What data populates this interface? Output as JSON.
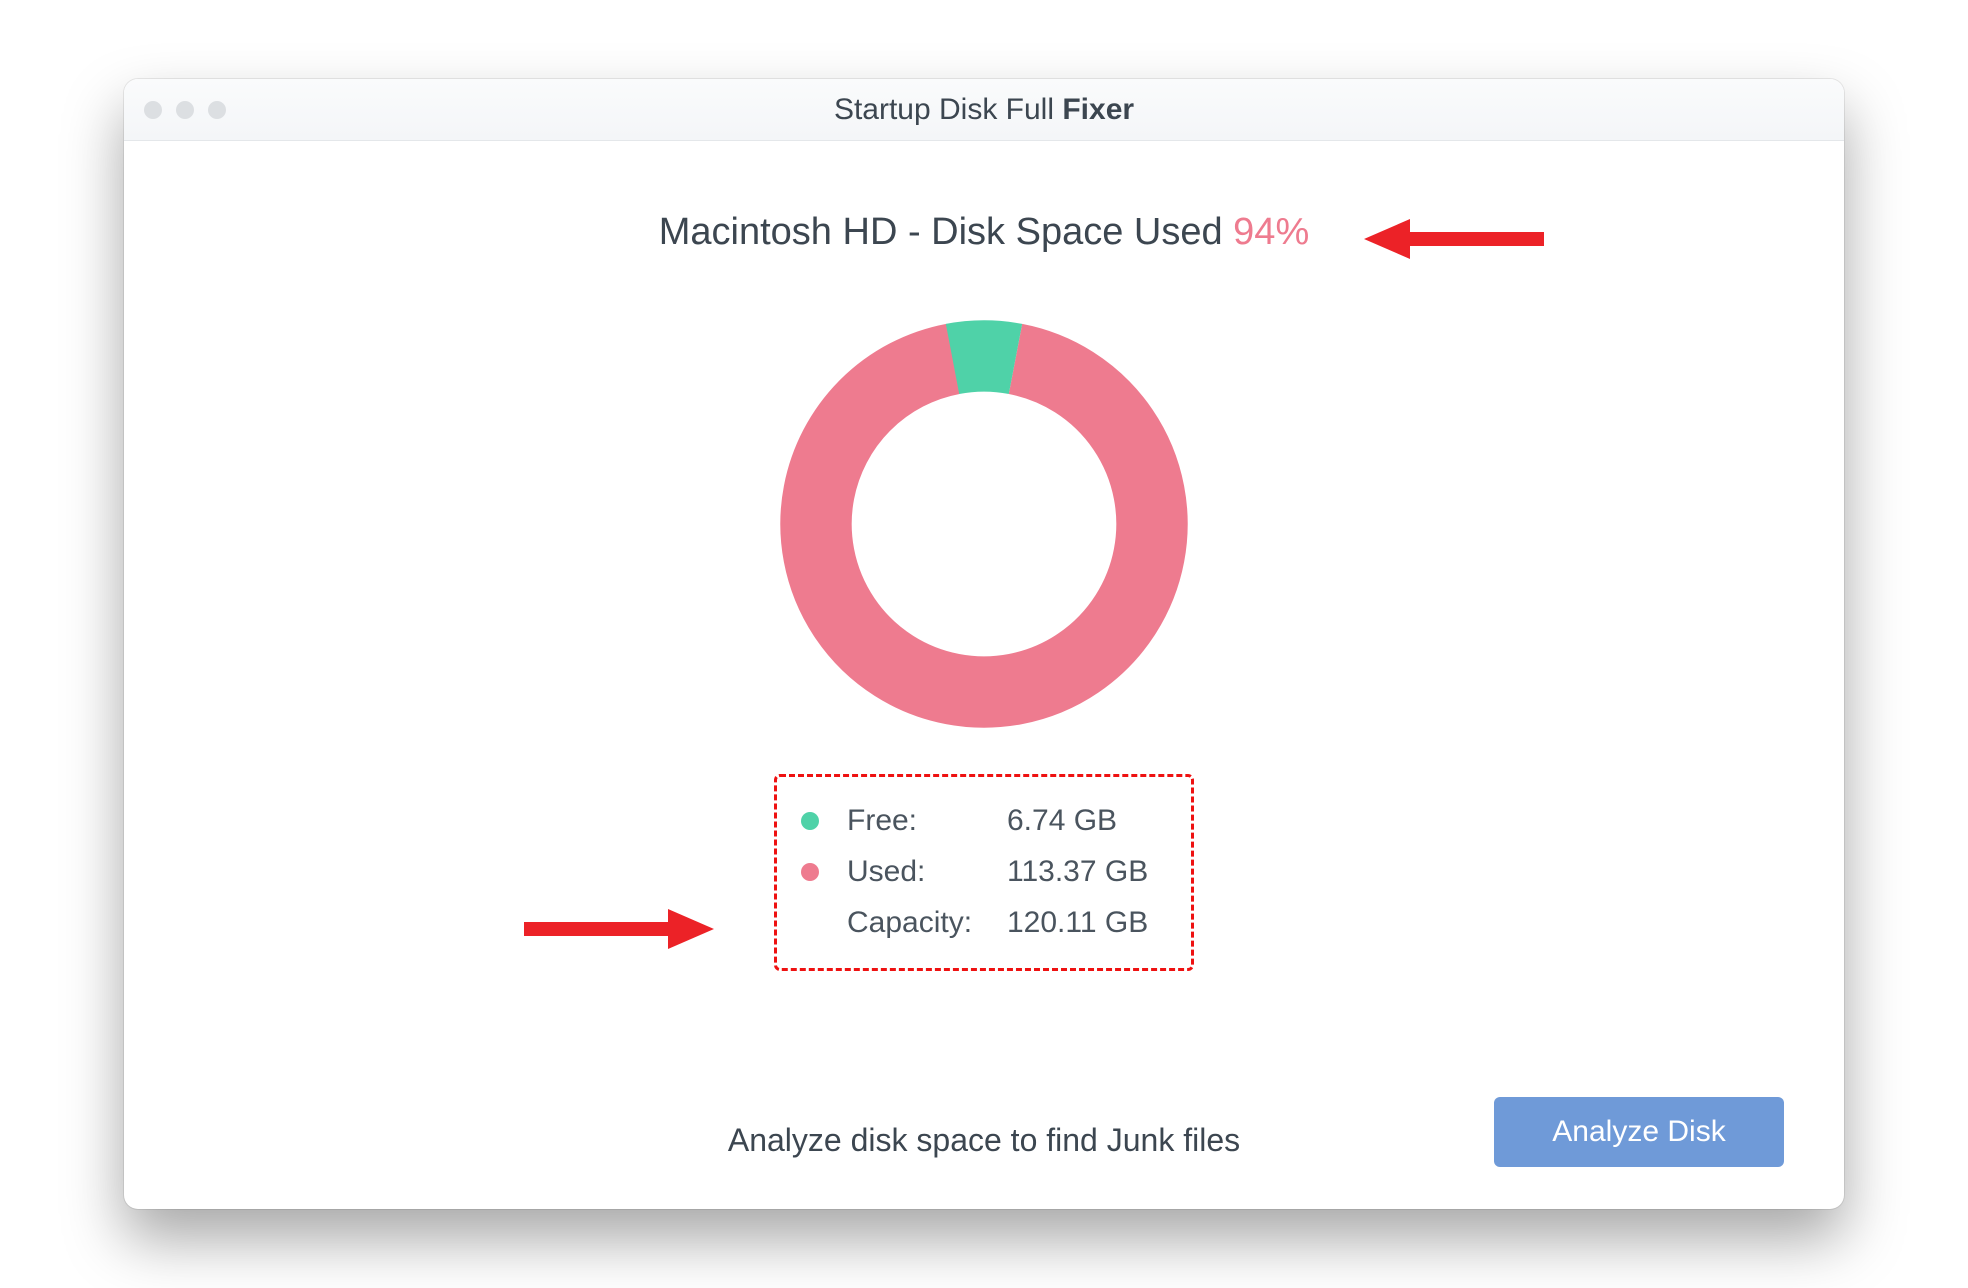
{
  "title": {
    "prefix": "Startup Disk Full ",
    "bold": "Fixer"
  },
  "headline": {
    "label": "Macintosh HD - Disk Space Used ",
    "percent": "94%"
  },
  "legend": {
    "free": {
      "label": "Free:",
      "value": "6.74 GB",
      "color": "#4fd2a8"
    },
    "used": {
      "label": "Used:",
      "value": "113.37 GB",
      "color": "#ee7b8f"
    },
    "cap": {
      "label": "Capacity:",
      "value": "120.11 GB"
    }
  },
  "footer_text": "Analyze disk space to find Junk files",
  "analyze_button": "Analyze Disk",
  "colors": {
    "used": "#ee7b8f",
    "free": "#4fd2a8",
    "annotation": "#ec2227"
  },
  "chart_data": {
    "type": "pie",
    "title": "Macintosh HD - Disk Space Used 94%",
    "series": [
      {
        "name": "Used",
        "value": 113.37,
        "percent": 94,
        "color": "#ee7b8f"
      },
      {
        "name": "Free",
        "value": 6.74,
        "percent": 6,
        "color": "#4fd2a8"
      }
    ],
    "capacity_gb": 120.11,
    "units": "GB",
    "style": "donut"
  }
}
